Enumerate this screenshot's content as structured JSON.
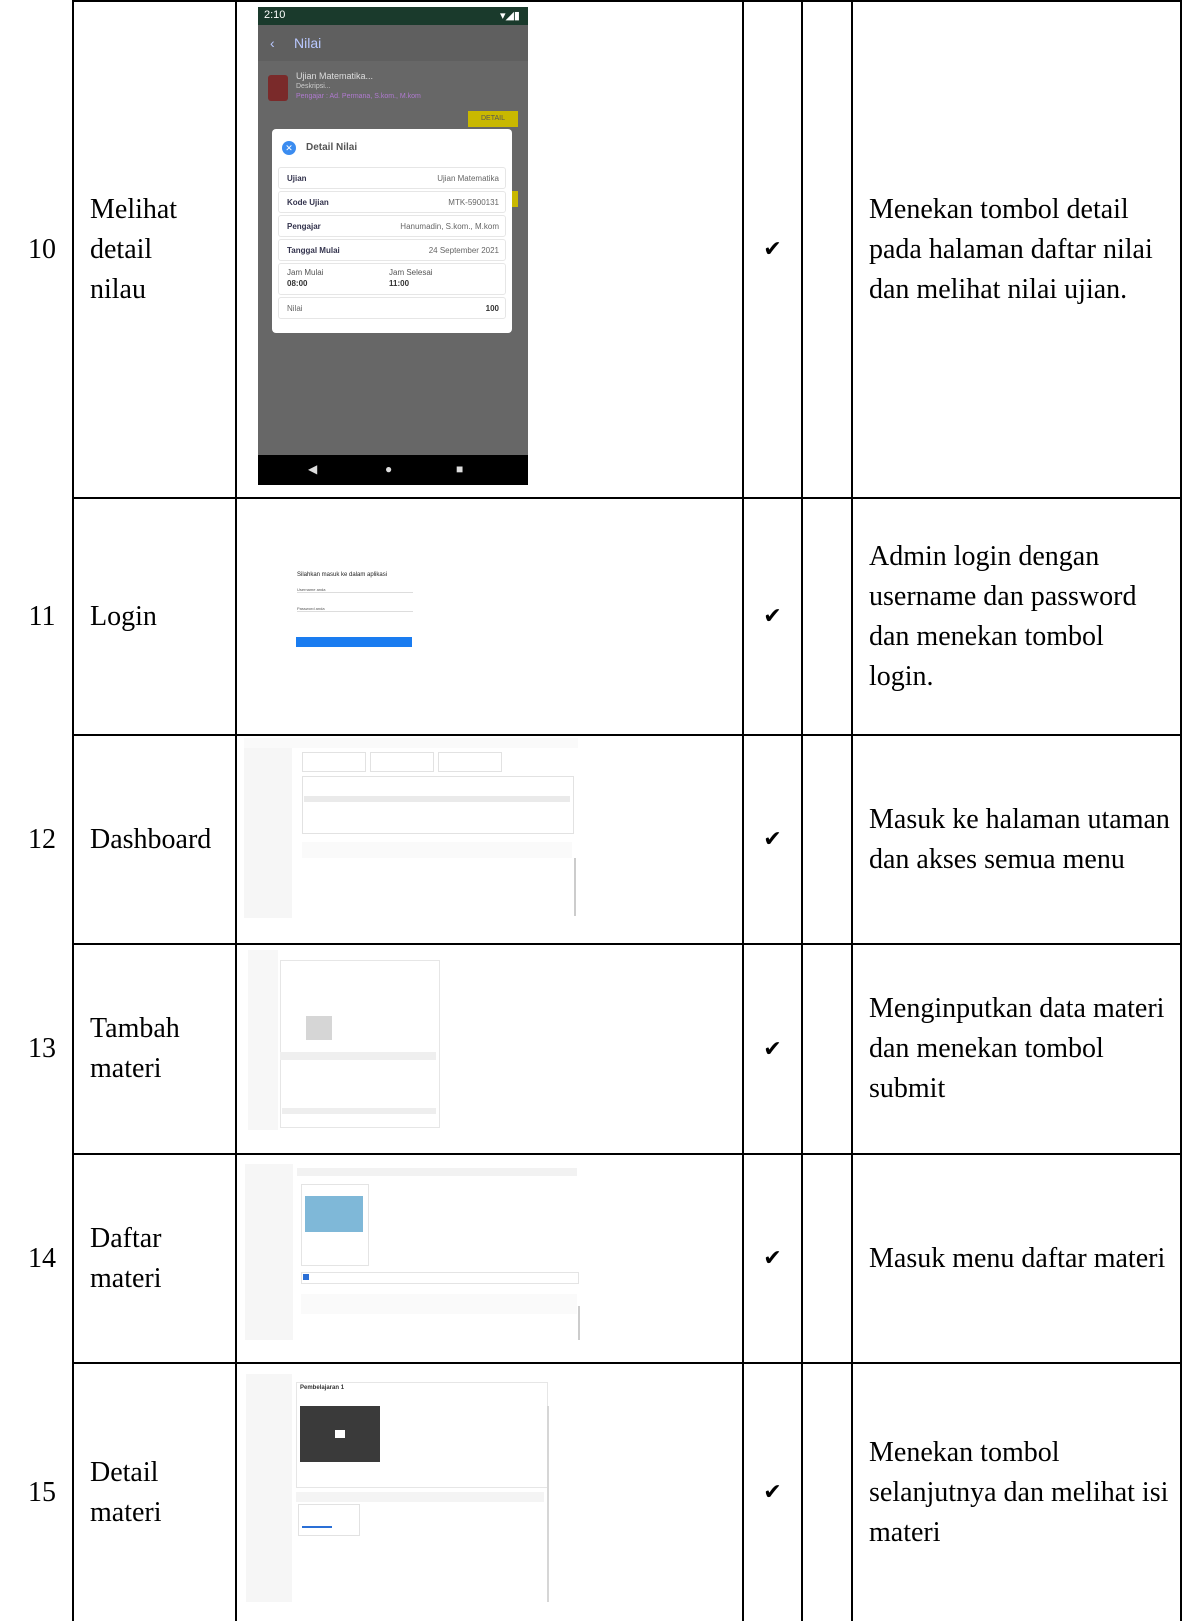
{
  "rows": [
    {
      "no": "10",
      "name": "Melihat detail nilau",
      "check": "✔",
      "desc": "Menekan tombol detail pada halaman daftar nilai dan melihat nilai ujian."
    },
    {
      "no": "11",
      "name": "Login",
      "check": "✔",
      "desc": "Admin login dengan username dan password dan menekan tombol login."
    },
    {
      "no": "12",
      "name": "Dashboard",
      "check": "✔",
      "desc": "Masuk ke halaman utaman dan akses semua menu"
    },
    {
      "no": "13",
      "name": "Tambah materi",
      "check": "✔",
      "desc": "Menginputkan data materi dan menekan tombol submit"
    },
    {
      "no": "14",
      "name": "Daftar materi",
      "check": "✔",
      "desc": "Masuk menu daftar materi"
    },
    {
      "no": "15",
      "name": "Detail materi",
      "check": "✔",
      "desc": "Menekan tombol selanjutnya dan melihat isi materi"
    }
  ],
  "phone": {
    "time": "2:10",
    "appbar_title": "Nilai",
    "exam_title": "Ujian Matematika...",
    "exam_desc": "Deskripsi...",
    "exam_teacher": "Pengajar : Ad. Permana, S.kom., M.kom",
    "detail_button": "DETAIL",
    "dialog_title": "Detail Nilai",
    "fields": [
      {
        "label": "Ujian",
        "value": "Ujian Matematika"
      },
      {
        "label": "Kode Ujian",
        "value": "MTK-5900131"
      },
      {
        "label": "Pengajar",
        "value": "Hanumadin, S.kom., M.kom"
      },
      {
        "label": "Tanggal Mulai",
        "value": "24 September 2021"
      }
    ],
    "jam_mulai_label": "Jam Mulai",
    "jam_mulai": "08:00",
    "jam_selesai_label": "Jam Selesai",
    "jam_selesai": "11:00",
    "nilai_label": "Nilai",
    "nilai": "100"
  },
  "login": {
    "heading": "Silahkan masuk ke dalam aplikasi",
    "username_placeholder": "Username anda",
    "password_placeholder": "Password anda"
  },
  "materi_detail": {
    "title": "Pembelajaran 1"
  }
}
